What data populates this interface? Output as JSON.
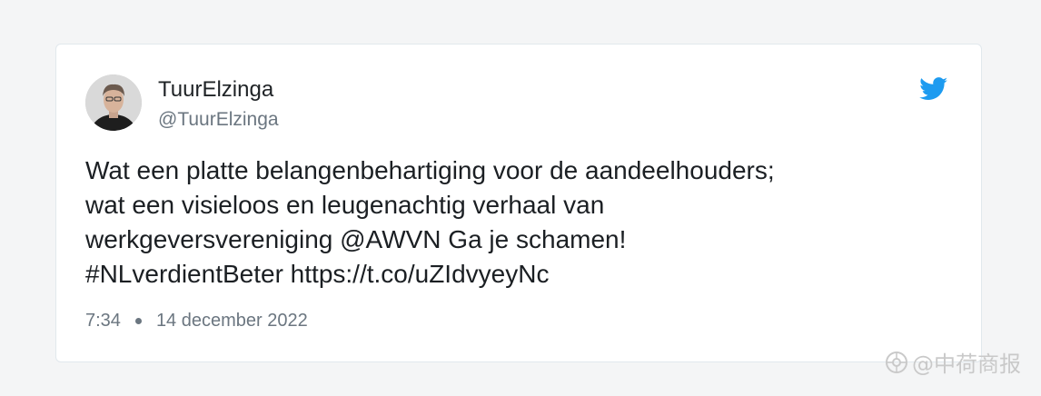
{
  "tweet": {
    "display_name": "TuurElzinga",
    "handle": "@TuurElzinga",
    "text_lines": [
      "Wat een platte belangenbehartiging voor de aandeelhouders;",
      "wat een visieloos en leugenachtig verhaal van",
      "werkgeversvereniging @AWVN Ga je schamen!",
      "#NLverdientBeter https://t.co/uZIdvyeyNc"
    ],
    "time": "7:34",
    "date": "14 december 2022",
    "brand_icon": "twitter-bird-icon",
    "brand_color": "#1d9bf0"
  },
  "watermark": {
    "text": "@中荷商报",
    "icon": "camera-icon"
  }
}
